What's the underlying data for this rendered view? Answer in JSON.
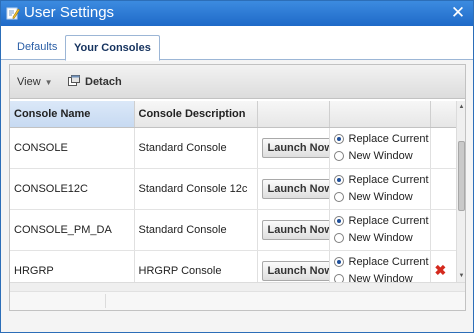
{
  "window": {
    "title": "User Settings",
    "title_icon": "edit-settings-icon",
    "close_icon": "close-icon"
  },
  "tabs": [
    {
      "label": "Defaults",
      "active": false
    },
    {
      "label": "Your Consoles",
      "active": true
    }
  ],
  "toolbar": {
    "view_label": "View",
    "view_caret_icon": "dropdown-arrow-icon",
    "detach_label": "Detach",
    "detach_icon": "detach-icon"
  },
  "table": {
    "columns": [
      "Console Name",
      "Console Description",
      "",
      "",
      ""
    ],
    "rows": [
      {
        "name": "CONSOLE",
        "description": "Standard Console",
        "launch_label": "Launch Now",
        "options": [
          "Replace Current",
          "New Window"
        ],
        "selected": 0,
        "deletable": false
      },
      {
        "name": "CONSOLE12C",
        "description": "Standard Console 12c",
        "launch_label": "Launch Now",
        "options": [
          "Replace Current",
          "New Window"
        ],
        "selected": 0,
        "deletable": false
      },
      {
        "name": "CONSOLE_PM_DA",
        "description": "Standard Console",
        "launch_label": "Launch Now",
        "options": [
          "Replace Current",
          "New Window"
        ],
        "selected": 0,
        "deletable": false
      },
      {
        "name": "HRGRP",
        "description": "HRGRP Console",
        "launch_label": "Launch Now",
        "options": [
          "Replace Current",
          "New Window"
        ],
        "selected": 0,
        "deletable": true
      }
    ]
  },
  "colors": {
    "titlebar": "#2a78d4",
    "delete_icon": "#d42a1e",
    "sorted_header": "#c7daf2"
  }
}
